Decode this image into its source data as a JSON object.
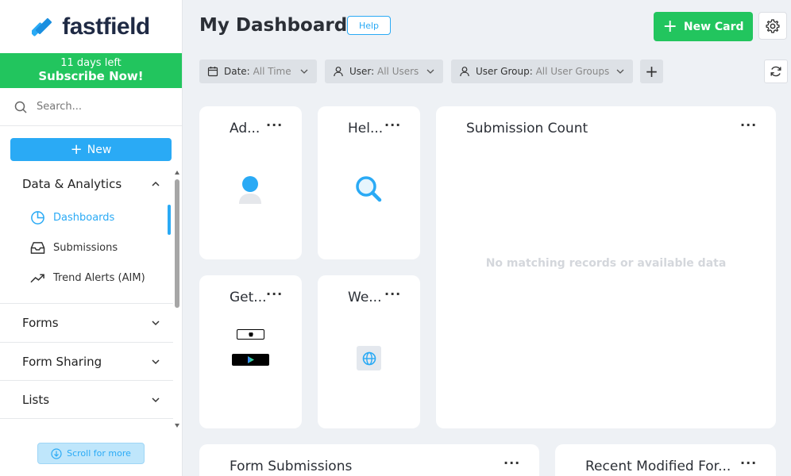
{
  "brand": {
    "name": "fastfield",
    "color": "#2aaaf5"
  },
  "trial": {
    "days_left": "11 days left",
    "cta": "Subscribe Now!"
  },
  "search": {
    "placeholder": "Search..."
  },
  "new_button": {
    "label": "New"
  },
  "nav": {
    "sections": [
      {
        "label": "Data & Analytics",
        "expanded": true
      },
      {
        "label": "Forms",
        "expanded": false
      },
      {
        "label": "Form Sharing",
        "expanded": false
      },
      {
        "label": "Lists",
        "expanded": false
      }
    ],
    "data_analytics_items": [
      {
        "label": "Dashboards",
        "icon": "pie-chart-icon",
        "active": true
      },
      {
        "label": "Submissions",
        "icon": "inbox-icon",
        "active": false
      },
      {
        "label": "Trend Alerts (AIM)",
        "icon": "trend-up-icon",
        "active": false
      }
    ]
  },
  "scroll_more": {
    "label": "Scroll for more"
  },
  "header": {
    "title": "My Dashboard",
    "help_label": "Help",
    "new_card_label": "New Card"
  },
  "filters": [
    {
      "label": "Date:",
      "value": "All Time",
      "icon": "calendar-icon"
    },
    {
      "label": "User:",
      "value": "All Users",
      "icon": "user-icon"
    },
    {
      "label": "User Group:",
      "value": "All User Groups",
      "icon": "user-icon"
    }
  ],
  "cards": {
    "ad": {
      "title": "Ad..."
    },
    "help": {
      "title": "Hel..."
    },
    "get": {
      "title": "Get..."
    },
    "we": {
      "title": "We..."
    },
    "submission_count": {
      "title": "Submission Count",
      "empty_message": "No matching records or available data"
    },
    "form_submissions": {
      "title": "Form Submissions"
    },
    "recent_modified": {
      "title": "Recent Modified For..."
    }
  },
  "colors": {
    "accent": "#2aaaf5",
    "green": "#22c55e",
    "background": "#eef1f5"
  }
}
